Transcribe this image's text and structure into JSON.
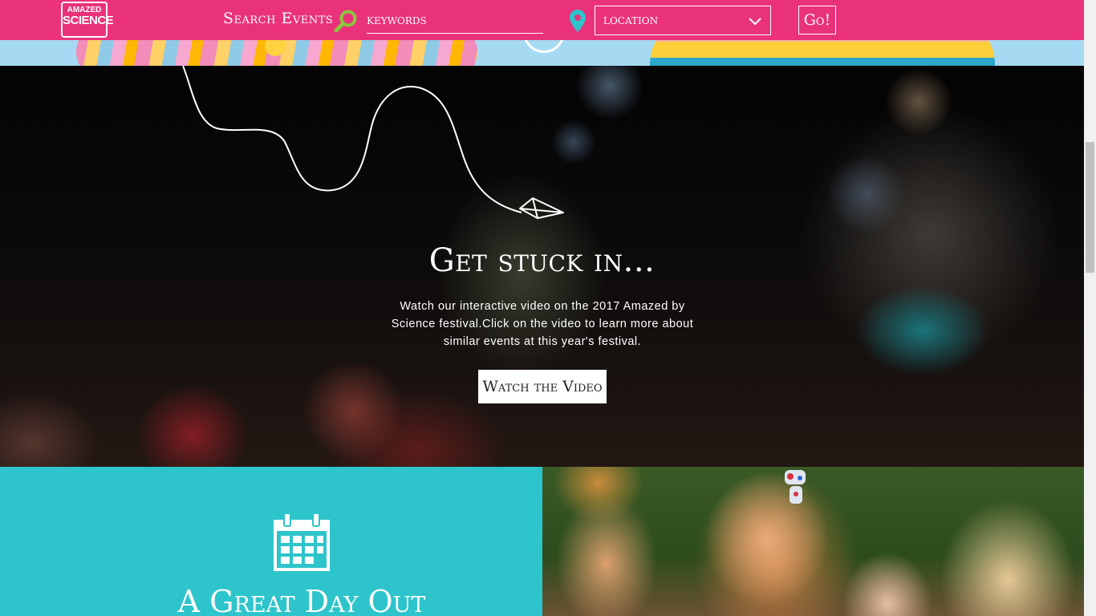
{
  "header": {
    "logo": {
      "line1": "AMAZED",
      "line2": "SCIENCE"
    },
    "search_label": "Search Events",
    "keywords_placeholder": "keywords",
    "location_value": "location",
    "go_label": "Go!"
  },
  "video_section": {
    "title": "Get stuck in...",
    "description": "Watch our interactive video on the 2017 Amazed by Science festival.Click on the video to learn more about similar events at this year's festival.",
    "button_label": "Watch the Video"
  },
  "day_out": {
    "title": "A Great Day Out"
  },
  "colors": {
    "brand_pink": "#e9327a",
    "teal": "#2ec4cb",
    "search_icon_green": "#8cc63f",
    "pin_teal": "#2ec4cb"
  },
  "icons": [
    "search-icon",
    "location-pin-icon",
    "chevron-down-icon",
    "calendar-icon",
    "paper-plane-icon"
  ]
}
